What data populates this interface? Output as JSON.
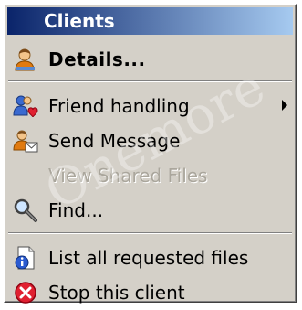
{
  "menu": {
    "title": "Clients",
    "items": [
      {
        "label": "Details...",
        "icon": "user-details-icon",
        "bold": true
      },
      {
        "label": "Friend handling",
        "icon": "friend-heart-icon",
        "submenu": true
      },
      {
        "label": "Send Message",
        "icon": "user-message-icon"
      },
      {
        "label": "View Shared Files",
        "disabled": true
      },
      {
        "label": "Find...",
        "icon": "magnifier-icon"
      },
      {
        "label": "List all requested files",
        "icon": "file-info-icon"
      },
      {
        "label": "Stop this client",
        "icon": "stop-icon"
      }
    ]
  },
  "watermark": "Onemore",
  "colors": {
    "title_start": "#0a246a",
    "title_end": "#a6caf0",
    "menu_bg": "#d4d0c8",
    "disabled_text": "#aaa69c"
  }
}
